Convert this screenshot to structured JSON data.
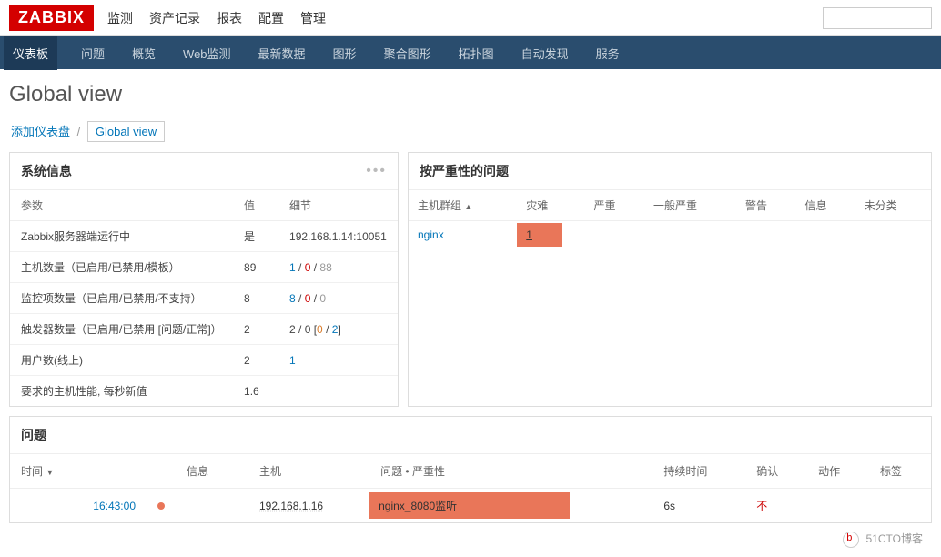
{
  "logo": "ZABBIX",
  "topNav": {
    "items": [
      "监测",
      "资产记录",
      "报表",
      "配置",
      "管理"
    ],
    "activeIndex": 0
  },
  "subNav": {
    "items": [
      "仪表板",
      "问题",
      "概览",
      "Web监测",
      "最新数据",
      "图形",
      "聚合图形",
      "拓扑图",
      "自动发现",
      "服务"
    ],
    "activeIndex": 0
  },
  "pageTitle": "Global view",
  "breadcrumb": {
    "root": "添加仪表盘",
    "current": "Global view"
  },
  "systemInfo": {
    "title": "系统信息",
    "headers": {
      "param": "参数",
      "value": "值",
      "detail": "细节"
    },
    "rows": [
      {
        "param": "Zabbix服务器端运行中",
        "value": "是",
        "valueClass": "val-yes",
        "detail": "192.168.1.14:10051"
      },
      {
        "param": "主机数量（已启用/已禁用/模板）",
        "value": "89",
        "detail_html": "<span class='val-link'>1</span> / <span class='val-red'>0</span> / <span class='val-gray'>88</span>"
      },
      {
        "param": "监控项数量（已启用/已禁用/不支持）",
        "value": "8",
        "detail_html": "<span class='val-link'>8</span> / <span class='val-red'>0</span> / <span class='val-gray'>0</span>"
      },
      {
        "param": "触发器数量（已启用/已禁用 [问题/正常]）",
        "value": "2",
        "detail_html": "2 / 0 [<span class='val-orange'>0</span> / <span class='val-link'>2</span>]"
      },
      {
        "param": "用户数(线上)",
        "value": "2",
        "detail_html": "<span class='val-link'>1</span>"
      },
      {
        "param": "要求的主机性能, 每秒新值",
        "value": "1.6",
        "detail": ""
      }
    ]
  },
  "severityWidget": {
    "title": "按严重性的问题",
    "headers": [
      "主机群组",
      "灾难",
      "严重",
      "一般严重",
      "警告",
      "信息",
      "未分类"
    ],
    "row": {
      "group": "nginx",
      "severe": "1"
    }
  },
  "problemsWidget": {
    "title": "问题",
    "headers": {
      "time": "时间",
      "info": "信息",
      "host": "主机",
      "problem": "问题 • 严重性",
      "duration": "持续时间",
      "ack": "确认",
      "action": "动作",
      "tag": "标签"
    },
    "row": {
      "time": "16:43:00",
      "host": "192.168.1.16",
      "problem": "nginx_8080监听",
      "duration": "6s",
      "ack": "不"
    }
  },
  "watermark": "51CTO博客"
}
